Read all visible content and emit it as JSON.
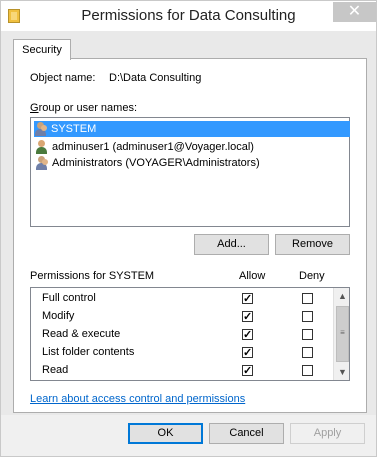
{
  "window": {
    "title": "Permissions for Data Consulting",
    "close_glyph": "✕"
  },
  "tabs": [
    {
      "label": "Security"
    }
  ],
  "object": {
    "label": "Object name:",
    "value": "D:\\Data Consulting"
  },
  "groups": {
    "label": "Group or user names:",
    "items": [
      {
        "label": "SYSTEM",
        "icon": "group-user-icon",
        "selected": true
      },
      {
        "label": "adminuser1 (adminuser1@Voyager.local)",
        "icon": "user-icon",
        "selected": false
      },
      {
        "label": "Administrators (VOYAGER\\Administrators)",
        "icon": "group-user-icon",
        "selected": false
      }
    ]
  },
  "buttons": {
    "add": "Add...",
    "remove": "Remove",
    "ok": "OK",
    "cancel": "Cancel",
    "apply": "Apply"
  },
  "permissions": {
    "label": "Permissions for SYSTEM",
    "allow_header": "Allow",
    "deny_header": "Deny",
    "rows": [
      {
        "name": "Full control",
        "allow": true,
        "deny": false
      },
      {
        "name": "Modify",
        "allow": true,
        "deny": false
      },
      {
        "name": "Read & execute",
        "allow": true,
        "deny": false
      },
      {
        "name": "List folder contents",
        "allow": true,
        "deny": false
      },
      {
        "name": "Read",
        "allow": true,
        "deny": false
      }
    ]
  },
  "link": {
    "text": "Learn about access control and permissions"
  },
  "colors": {
    "selection": "#3399ff",
    "link": "#0066cc",
    "primary_border": "#0078d7"
  }
}
